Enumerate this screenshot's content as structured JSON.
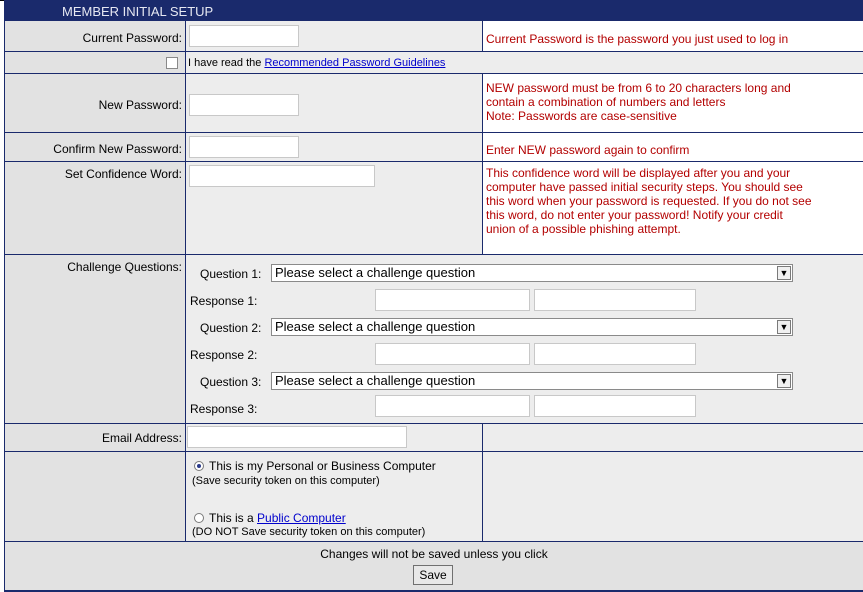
{
  "form": {
    "title": "MEMBER INITIAL SETUP",
    "current_password": {
      "label": "Current Password:",
      "value": "",
      "note": "Current Password is the password you just used to log in"
    },
    "guidelines": {
      "prefix": "I have read the ",
      "link": "Recommended Password Guidelines",
      "checked": false
    },
    "new_password": {
      "label": "New Password:",
      "value": "",
      "note_line1": "NEW password must be from 6 to 20 characters long and",
      "note_line2": "contain a combination of numbers and letters",
      "note_line3": "Note: Passwords are case-sensitive"
    },
    "confirm_password": {
      "label": "Confirm New Password:",
      "value": "",
      "note": "Enter NEW password again to confirm"
    },
    "confidence_word": {
      "label": "Set Confidence Word:",
      "value": "",
      "note_line1": "This confidence word will be displayed after you and your",
      "note_line2": "computer have passed initial security steps. You should see",
      "note_line3": "this word when your password is requested. If you do not see",
      "note_line4": "this word, do not enter your password! Notify your credit",
      "note_line5": "union of a possible phishing attempt."
    },
    "challenge": {
      "label": "Challenge Questions:",
      "questions": [
        {
          "q_label": "Question 1:",
          "selected": "Please select a challenge question",
          "r_label": "Response 1:",
          "r_value": "",
          "r_confirm": ""
        },
        {
          "q_label": "Question 2:",
          "selected": "Please select a challenge question",
          "r_label": "Response 2:",
          "r_value": "",
          "r_confirm": ""
        },
        {
          "q_label": "Question 3:",
          "selected": "Please select a challenge question",
          "r_label": "Response 3:",
          "r_value": "",
          "r_confirm": ""
        }
      ]
    },
    "email": {
      "label": "Email Address:",
      "value": ""
    },
    "computer_type": {
      "personal_label": "This is my Personal or Business Computer",
      "personal_sub": "(Save security token on this computer)",
      "public_prefix": "This is a ",
      "public_link": "Public Computer",
      "public_sub": "(DO NOT Save security token on this computer)",
      "selected": "personal"
    },
    "footer": {
      "message": "Changes will not be saved unless you click",
      "save_label": "Save"
    }
  }
}
